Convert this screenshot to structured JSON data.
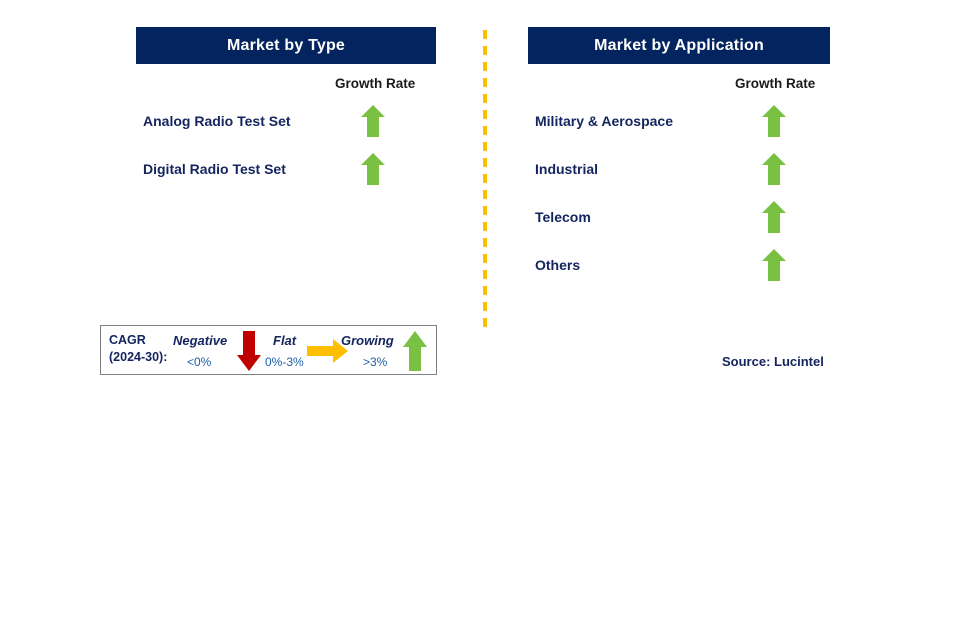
{
  "panels": [
    {
      "id": "type",
      "title": "Market by Type",
      "growth_rate_header": "Growth Rate",
      "rows": [
        {
          "label": "Analog Radio Test Set",
          "trend": "growing",
          "icon": "up-arrow-icon"
        },
        {
          "label": "Digital Radio Test Set",
          "trend": "growing",
          "icon": "up-arrow-icon"
        }
      ]
    },
    {
      "id": "application",
      "title": "Market by Application",
      "growth_rate_header": "Growth Rate",
      "rows": [
        {
          "label": "Military & Aerospace",
          "trend": "growing",
          "icon": "up-arrow-icon"
        },
        {
          "label": "Industrial",
          "trend": "growing",
          "icon": "up-arrow-icon"
        },
        {
          "label": "Telecom",
          "trend": "growing",
          "icon": "up-arrow-icon"
        },
        {
          "label": "Others",
          "trend": "growing",
          "icon": "up-arrow-icon"
        }
      ]
    }
  ],
  "legend": {
    "title_line1": "CAGR",
    "title_line2": "(2024-30):",
    "items": [
      {
        "term": "Negative",
        "range": "<0%",
        "icon": "down-arrow-icon",
        "color": "#c00000"
      },
      {
        "term": "Flat",
        "range": "0%-3%",
        "icon": "right-arrow-icon",
        "color": "#ffbe00"
      },
      {
        "term": "Growing",
        "range": ">3%",
        "icon": "up-arrow-icon",
        "color": "#7ac143"
      }
    ]
  },
  "source": "Source: Lucintel",
  "colors": {
    "header_bar": "#04245f",
    "label_navy": "#14245f",
    "growing_green": "#7ac143",
    "negative_red": "#c00000",
    "flat_yellow": "#ffbe00",
    "divider_orange": "#ffbe00",
    "legend_range_blue": "#1f5fa9"
  }
}
